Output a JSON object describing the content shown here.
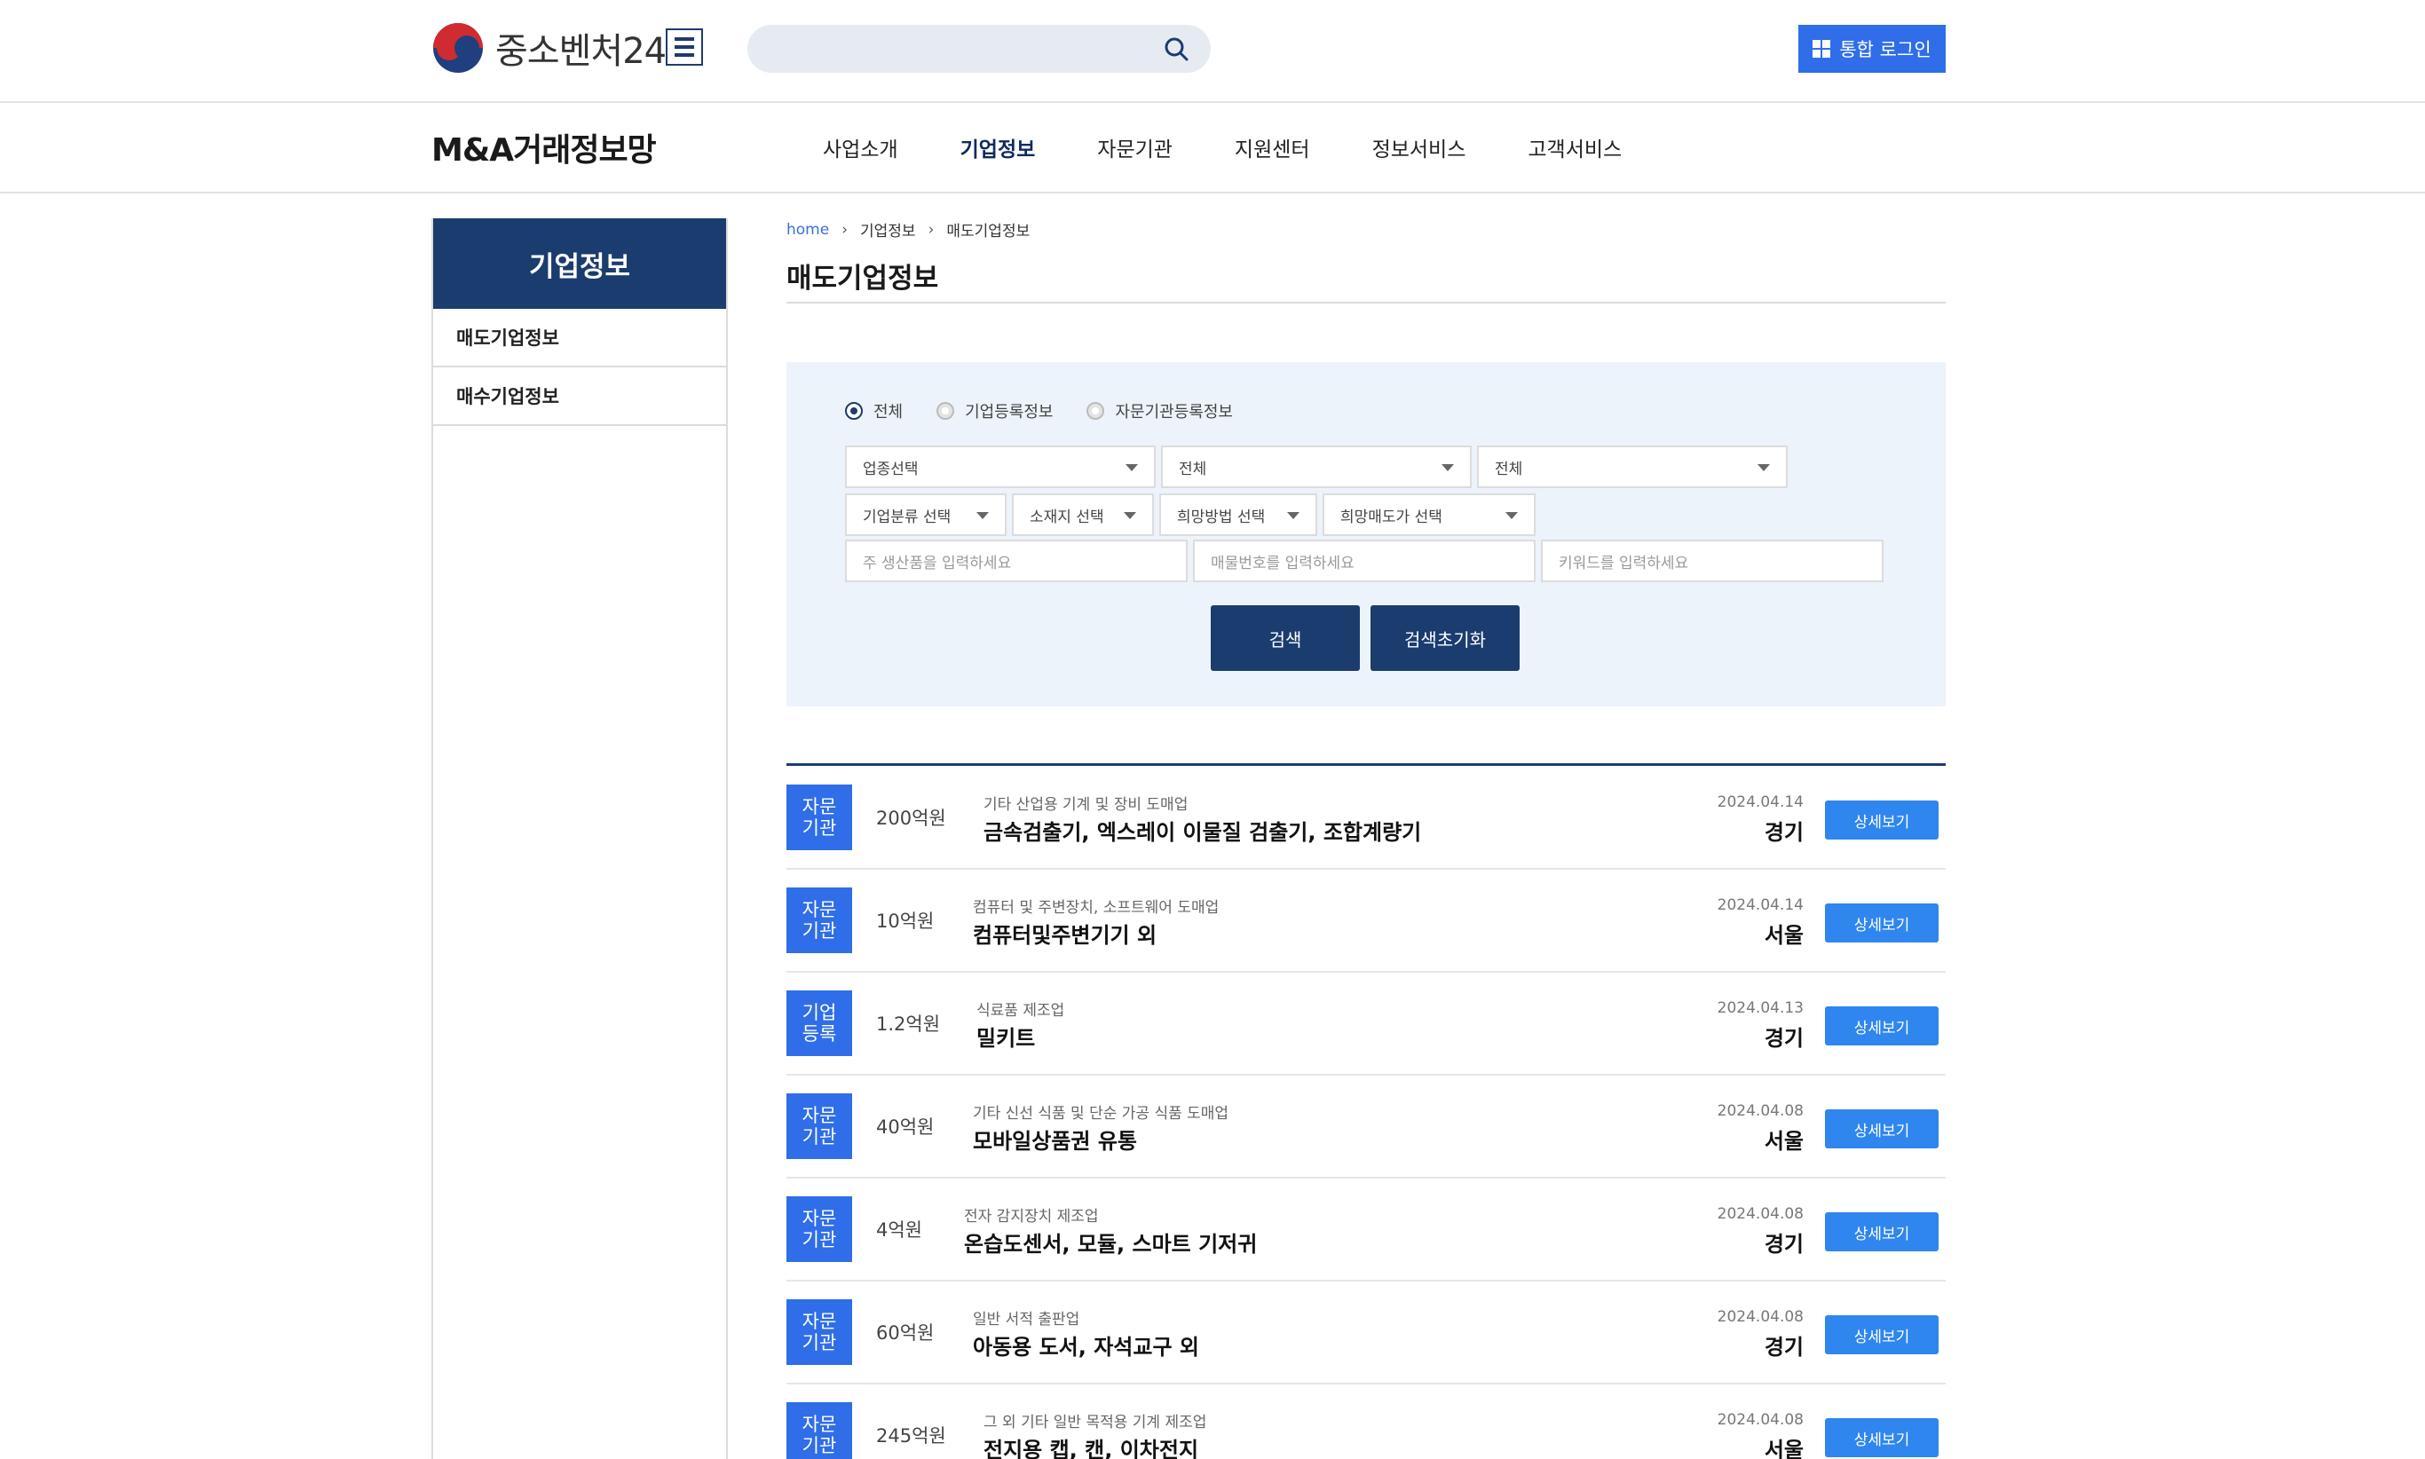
{
  "header": {
    "logo_text": "중소벤처24",
    "login_label": "통합 로그인"
  },
  "navbar": {
    "site_title": "M&A거래정보망",
    "items": [
      "사업소개",
      "기업정보",
      "자문기관",
      "지원센터",
      "정보서비스",
      "고객서비스"
    ],
    "active_index": 1
  },
  "sidebar": {
    "heading": "기업정보",
    "items": [
      "매도기업정보",
      "매수기업정보"
    ]
  },
  "breadcrumb": [
    "home",
    "기업정보",
    "매도기업정보"
  ],
  "page_title": "매도기업정보",
  "filter": {
    "radios": [
      "전체",
      "기업등록정보",
      "자문기관등록정보"
    ],
    "selected_radio": 0,
    "selects_row1": [
      "업종선택",
      "전체",
      "전체"
    ],
    "selects_row2": [
      "기업분류 선택",
      "소재지 선택",
      "희망방법 선택",
      "희망매도가 선택"
    ],
    "placeholders": [
      "주 생산품을 입력하세요",
      "매물번호를 입력하세요",
      "키워드를 입력하세요"
    ],
    "search_label": "검색",
    "reset_label": "검색초기화"
  },
  "listings": [
    {
      "badge_line1": "자문",
      "badge_line2": "기관",
      "price": "200억원",
      "category": "기타 산업용 기계 및 장비 도매업",
      "name": "금속검출기, 엑스레이 이물질 검출기, 조합계량기",
      "date": "2024.04.14",
      "region": "경기",
      "detail_label": "상세보기"
    },
    {
      "badge_line1": "자문",
      "badge_line2": "기관",
      "price": "10억원",
      "category": "컴퓨터 및 주변장치, 소프트웨어 도매업",
      "name": "컴퓨터및주변기기 외",
      "date": "2024.04.14",
      "region": "서울",
      "detail_label": "상세보기"
    },
    {
      "badge_line1": "기업",
      "badge_line2": "등록",
      "price": "1.2억원",
      "category": "식료품 제조업",
      "name": "밀키트",
      "date": "2024.04.13",
      "region": "경기",
      "detail_label": "상세보기"
    },
    {
      "badge_line1": "자문",
      "badge_line2": "기관",
      "price": "40억원",
      "category": "기타 신선 식품 및 단순 가공 식품 도매업",
      "name": "모바일상품권 유통",
      "date": "2024.04.08",
      "region": "서울",
      "detail_label": "상세보기"
    },
    {
      "badge_line1": "자문",
      "badge_line2": "기관",
      "price": "4억원",
      "category": "전자 감지장치 제조업",
      "name": "온습도센서, 모듈, 스마트 기저귀",
      "date": "2024.04.08",
      "region": "경기",
      "detail_label": "상세보기"
    },
    {
      "badge_line1": "자문",
      "badge_line2": "기관",
      "price": "60억원",
      "category": "일반 서적 출판업",
      "name": "아동용 도서, 자석교구 외",
      "date": "2024.04.08",
      "region": "경기",
      "detail_label": "상세보기"
    },
    {
      "badge_line1": "자문",
      "badge_line2": "기관",
      "price": "245억원",
      "category": "그 외 기타 일반 목적용 기계 제조업",
      "name": "전지용 캡, 캔, 이차전지",
      "date": "2024.04.08",
      "region": "서울",
      "detail_label": "상세보기"
    }
  ]
}
